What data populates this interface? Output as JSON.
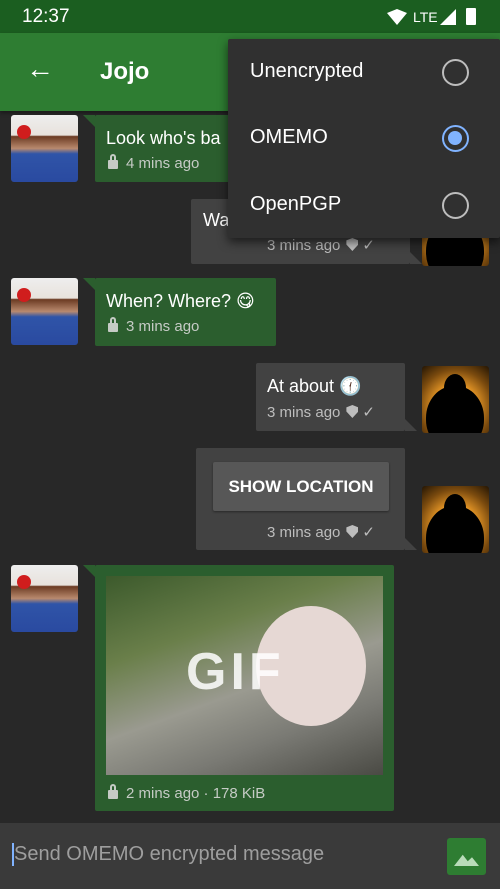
{
  "status_bar": {
    "time": "12:37",
    "network": "LTE",
    "icons": [
      "wifi-icon",
      "signal-icon",
      "battery-icon"
    ]
  },
  "toolbar": {
    "title": "Jojo",
    "back_icon": "arrow-left-icon"
  },
  "messages": [
    {
      "direction": "received",
      "text": "Look who's ba",
      "time": "4 mins ago",
      "encrypted": true
    },
    {
      "direction": "sent",
      "text": "Wa",
      "time": "3 mins ago",
      "status": "delivered"
    },
    {
      "direction": "received",
      "text": "When? Where? 😋",
      "time": "3 mins ago",
      "encrypted": true
    },
    {
      "direction": "sent",
      "text": "At about 🕧",
      "time": "3 mins ago",
      "status": "delivered"
    },
    {
      "direction": "sent",
      "button": "SHOW LOCATION",
      "time": "3 mins ago",
      "status": "delivered"
    },
    {
      "direction": "received",
      "image_label": "GIF",
      "time": "2 mins ago · 178 KiB",
      "encrypted": true
    }
  ],
  "encryption_menu": {
    "items": [
      {
        "label": "Unencrypted",
        "selected": false
      },
      {
        "label": "OMEMO",
        "selected": true
      },
      {
        "label": "OpenPGP",
        "selected": false
      }
    ]
  },
  "composer": {
    "placeholder": "Send OMEMO encrypted message",
    "send_icon": "image-icon"
  },
  "colors": {
    "status_bar": "#1b5e20",
    "toolbar": "#2e7d32",
    "received_bubble": "#2b5e2e",
    "sent_bubble": "#424242",
    "accent": "#80b3ff"
  }
}
